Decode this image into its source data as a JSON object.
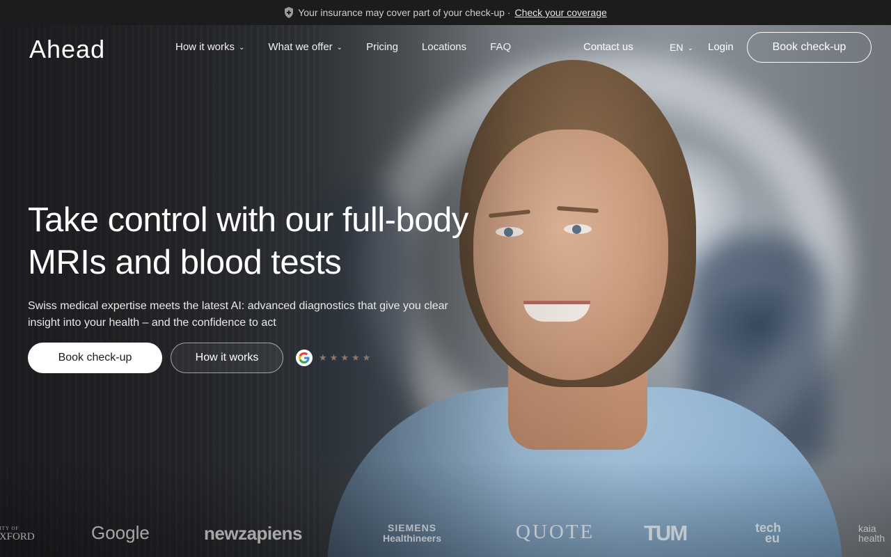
{
  "announcement": {
    "text": "Your insurance may cover part of your check-up ·",
    "link": "Check your coverage",
    "icon": "shield-icon"
  },
  "header": {
    "logo": "Ahead",
    "nav": [
      {
        "label": "How it works",
        "dropdown": true
      },
      {
        "label": "What we offer",
        "dropdown": true
      },
      {
        "label": "Pricing",
        "dropdown": false
      },
      {
        "label": "Locations",
        "dropdown": false
      },
      {
        "label": "FAQ",
        "dropdown": false
      }
    ],
    "contact": "Contact us",
    "language": "EN",
    "login": "Login",
    "cta": "Book check-up"
  },
  "hero": {
    "headline": "Take control with our full-body MRIs and blood tests",
    "subtitle": "Swiss medical expertise meets the latest AI: advanced diagnostics that give you clear insight into your health – and the confidence to act",
    "primary_cta": "Book check-up",
    "secondary_cta": "How it works",
    "rating": {
      "icon": "google-icon",
      "stars": 5,
      "star_glyph": "★"
    }
  },
  "partners": {
    "oxford_small": "UNIVERSITY OF",
    "oxford_big": "OXFORD",
    "google": "Google",
    "newzapiens": "newzapiens",
    "siemens_1": "SIEMENS",
    "siemens_2": "Healthineers",
    "quote": "QUOTE",
    "tum": "TUM",
    "techeu_1": "tech",
    "techeu_2": "eu",
    "kaia_1": "kaia",
    "kaia_2": "health"
  },
  "colors": {
    "topbar": "#1c1c1c",
    "primary_button_bg": "#ffffff",
    "primary_button_text": "#1b1b1b",
    "star": "#8a7a6a"
  }
}
